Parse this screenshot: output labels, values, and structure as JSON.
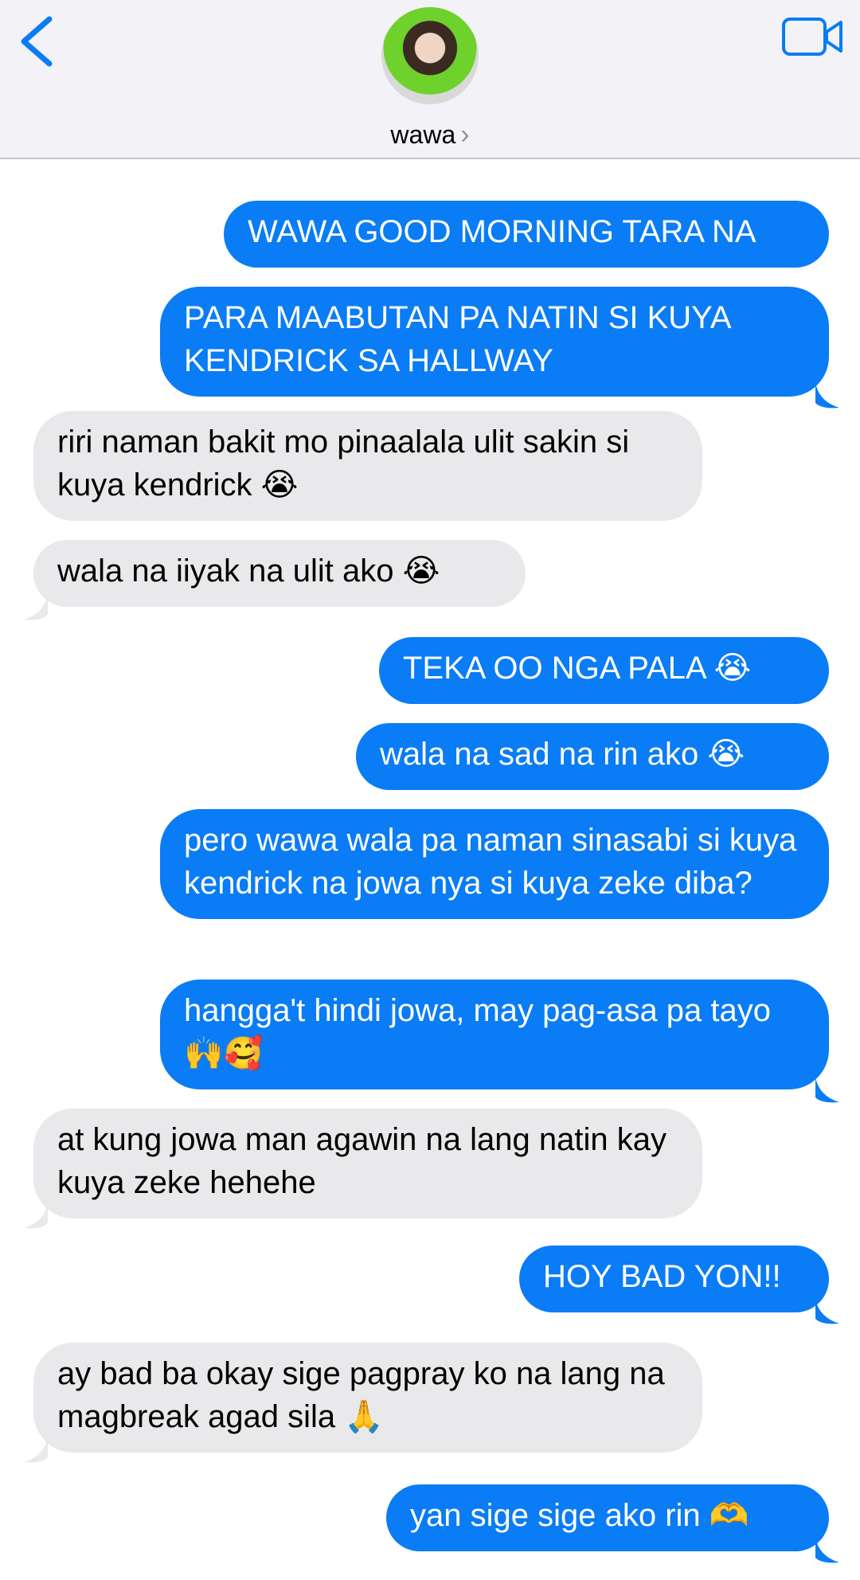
{
  "header": {
    "contact_name": "wawa",
    "chevron": "›",
    "icons": {
      "back": "chevron-left-icon",
      "video": "video-camera-icon"
    },
    "accent": "#0a7cf5"
  },
  "messages": [
    {
      "from": "me",
      "text": "WAWA GOOD MORNING TARA NA"
    },
    {
      "from": "me",
      "text": "PARA MAABUTAN PA NATIN SI KUYA KENDRICK SA HALLWAY"
    },
    {
      "from": "them",
      "text": "riri naman bakit mo pinaalala ulit sakin si kuya kendrick 😭"
    },
    {
      "from": "them",
      "text": "wala na iiyak na ulit ako 😭"
    },
    {
      "from": "me",
      "text": "TEKA OO NGA PALA 😭"
    },
    {
      "from": "me",
      "text": "wala na sad na rin ako 😭"
    },
    {
      "from": "me",
      "text": "pero wawa wala pa naman sinasabi si kuya kendrick na jowa nya si kuya zeke diba?"
    },
    {
      "from": "me",
      "text": "hangga't hindi jowa, may pag-asa pa tayo 🙌🥰"
    },
    {
      "from": "them",
      "text": "at kung jowa man agawin na lang natin kay kuya zeke hehehe"
    },
    {
      "from": "me",
      "text": "HOY BAD YON!!"
    },
    {
      "from": "them",
      "text": "ay bad ba okay sige pagpray ko na lang na magbreak agad sila 🙏"
    },
    {
      "from": "me",
      "text": "yan sige sige ako rin 🫶"
    }
  ]
}
